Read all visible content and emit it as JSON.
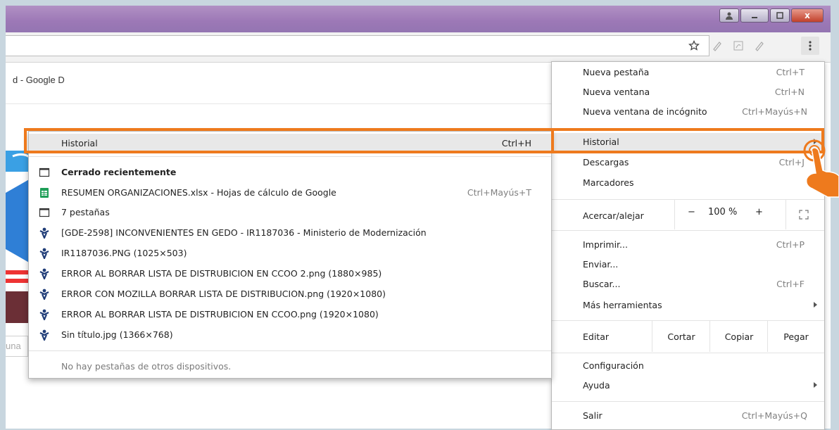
{
  "window": {
    "controls": [
      "user-icon",
      "minimize-icon",
      "maximize-icon",
      "close-icon"
    ],
    "close_glyph": "x"
  },
  "toolbar": {
    "icons": [
      "star-icon",
      "extension-icon",
      "pdf-icon",
      "extension-icon",
      "menu-icon"
    ]
  },
  "page": {
    "tab_title": "d - Google D",
    "left_field_text": "una"
  },
  "main_menu": {
    "items": [
      {
        "label": "Nueva pestaña",
        "shortcut": "Ctrl+T"
      },
      {
        "label": "Nueva ventana",
        "shortcut": "Ctrl+N"
      },
      {
        "label": "Nueva ventana de incógnito",
        "shortcut": "Ctrl+Mayús+N"
      },
      {
        "label": "Historial",
        "shortcut": ""
      },
      {
        "label": "Descargas",
        "shortcut": "Ctrl+J"
      },
      {
        "label": "Marcadores",
        "shortcut": ""
      }
    ],
    "zoom": {
      "label": "Acercar/alejar",
      "minus": "−",
      "value": "100 %",
      "plus": "+"
    },
    "items2": [
      {
        "label": "Imprimir...",
        "shortcut": "Ctrl+P"
      },
      {
        "label": "Enviar...",
        "shortcut": ""
      },
      {
        "label": "Buscar...",
        "shortcut": "Ctrl+F"
      },
      {
        "label": "Más herramientas",
        "shortcut": ""
      }
    ],
    "edit": {
      "label": "Editar",
      "cut": "Cortar",
      "copy": "Copiar",
      "paste": "Pegar"
    },
    "items3": [
      {
        "label": "Configuración"
      },
      {
        "label": "Ayuda"
      }
    ],
    "exit": {
      "label": "Salir",
      "shortcut": "Ctrl+Mayús+Q"
    }
  },
  "history_submenu": {
    "header": {
      "label": "Historial",
      "shortcut": "Ctrl+H"
    },
    "section_title": "Cerrado recientemente",
    "entries": [
      {
        "label": "RESUMEN ORGANIZACIONES.xlsx - Hojas de cálculo de Google",
        "shortcut": "Ctrl+Mayús+T",
        "icon": "sheets-icon"
      },
      {
        "label": "7 pestañas",
        "shortcut": "",
        "icon": "window-icon"
      },
      {
        "label": "[GDE-2598] INCONVENIENTES EN GEDO - IR1187036 - Ministerio de Modernización",
        "shortcut": "",
        "icon": "jira-icon"
      },
      {
        "label": "IR1187036.PNG (1025×503)",
        "shortcut": "",
        "icon": "jira-icon"
      },
      {
        "label": "ERROR AL BORRAR LISTA DE DISTRUBICION EN CCOO 2.png (1880×985)",
        "shortcut": "",
        "icon": "jira-icon"
      },
      {
        "label": "ERROR CON MOZILLA BORRAR LISTA DE DISTRIBUCION.png (1920×1080)",
        "shortcut": "",
        "icon": "jira-icon"
      },
      {
        "label": "ERROR AL BORRAR LISTA DE DISTRUBICION EN CCOO.png (1920×1080)",
        "shortcut": "",
        "icon": "jira-icon"
      },
      {
        "label": "Sin título.jpg (1366×768)",
        "shortcut": "",
        "icon": "jira-icon"
      }
    ],
    "footer": "No hay pestañas de otros dispositivos."
  },
  "colors": {
    "highlight": "#ee7a1d",
    "titlebar": "#9c78b6",
    "sheets_green": "#1e9e57",
    "jira_blue": "#1f3c77"
  }
}
